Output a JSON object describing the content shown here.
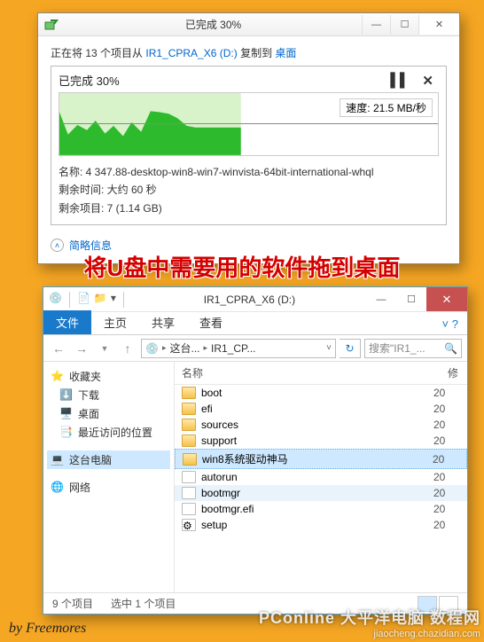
{
  "copy_dialog": {
    "title": "已完成 30%",
    "status_prefix": "正在将 13 个项目从 ",
    "src_link": "IR1_CPRA_X6 (D:)",
    "status_mid": " 复制到 ",
    "dst_link": "桌面",
    "progress_label": "已完成 30%",
    "speed_label": "速度: 21.5 MB/秒",
    "detail_name": "名称: 4 347.88-desktop-win8-win7-winvista-64bit-international-whql",
    "detail_time": "剩余时间: 大约 60 秒",
    "detail_remain": "剩余项目: 7 (1.14 GB)",
    "simple_info": "简略信息"
  },
  "overlay": "将U盘中需要用的软件拖到桌面",
  "explorer": {
    "title": "IR1_CPRA_X6 (D:)",
    "tabs": {
      "file": "文件",
      "home": "主页",
      "share": "共享",
      "view": "查看"
    },
    "breadcrumb": {
      "root": "这台...",
      "cur": "IR1_CP..."
    },
    "search_placeholder": "搜索\"IR1_...",
    "sidebar": {
      "fav": "收藏夹",
      "fav_items": [
        "下载",
        "桌面",
        "最近访问的位置"
      ],
      "pc": "这台电脑",
      "net": "网络"
    },
    "columns": {
      "name": "名称",
      "mod": "修"
    },
    "files": [
      {
        "name": "boot",
        "type": "folder",
        "mod": "20"
      },
      {
        "name": "efi",
        "type": "folder",
        "mod": "20"
      },
      {
        "name": "sources",
        "type": "folder",
        "mod": "20"
      },
      {
        "name": "support",
        "type": "folder",
        "mod": "20"
      },
      {
        "name": "win8系统驱动神马",
        "type": "folder",
        "mod": "20",
        "selected": true
      },
      {
        "name": "autorun",
        "type": "file",
        "mod": "20"
      },
      {
        "name": "bootmgr",
        "type": "file",
        "mod": "20",
        "hi": true
      },
      {
        "name": "bootmgr.efi",
        "type": "file",
        "mod": "20"
      },
      {
        "name": "setup",
        "type": "exe",
        "mod": "20"
      }
    ],
    "status": {
      "count": "9 个项目",
      "selected": "选中 1 个项目"
    }
  },
  "byline": "by Freemores",
  "watermark": {
    "top": "PConline 大平洋电脑 数程网",
    "bottom": "jiaocheng.chazidian.com"
  },
  "chart_data": {
    "type": "area",
    "title": "Copy speed over time",
    "ylabel": "MB/秒",
    "ylim": [
      0,
      45
    ],
    "x": [
      0,
      1,
      2,
      3,
      4,
      5,
      6,
      7,
      8,
      9,
      10,
      11,
      12,
      13,
      14,
      15,
      16,
      17,
      18,
      19,
      20
    ],
    "values": [
      31,
      15,
      22,
      18,
      25,
      16,
      21,
      14,
      24,
      17,
      32,
      31,
      30,
      27,
      21,
      20,
      20,
      20,
      20,
      20,
      20
    ],
    "current_value": 21.5,
    "fill_fraction": 0.48
  }
}
